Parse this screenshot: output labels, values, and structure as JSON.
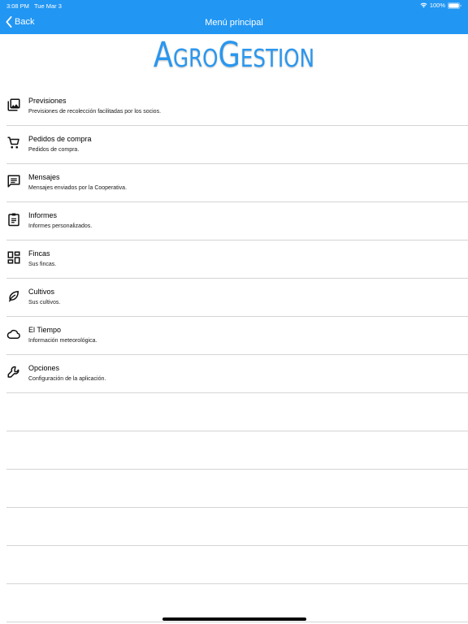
{
  "status": {
    "time": "3:08 PM",
    "date": "Tue Mar 3",
    "battery": "100%"
  },
  "nav": {
    "back_label": "Back",
    "title": "Menú principal"
  },
  "logo": {
    "text": "AgroGestion"
  },
  "menu": {
    "items": [
      {
        "icon": "photo-library-icon",
        "title": "Previsiones",
        "subtitle": "Previsiones de recolección facilitadas por los socios."
      },
      {
        "icon": "shopping-cart-icon",
        "title": "Pedidos de compra",
        "subtitle": "Pedidos de compra."
      },
      {
        "icon": "message-icon",
        "title": "Mensajes",
        "subtitle": "Mensajes enviados por la Cooperativa."
      },
      {
        "icon": "clipboard-icon",
        "title": "Informes",
        "subtitle": "Informes personalizados."
      },
      {
        "icon": "dashboard-icon",
        "title": "Fincas",
        "subtitle": "Sus fincas."
      },
      {
        "icon": "leaf-icon",
        "title": "Cultivos",
        "subtitle": "Sus cultivos."
      },
      {
        "icon": "cloud-icon",
        "title": "El Tiempo",
        "subtitle": "Información meteorológica."
      },
      {
        "icon": "wrench-icon",
        "title": "Opciones",
        "subtitle": "Configuración de la aplicación."
      }
    ]
  },
  "colors": {
    "nav_bar": "#2196f3",
    "logo": "#2a97ef",
    "divider": "#d4d4d4"
  }
}
